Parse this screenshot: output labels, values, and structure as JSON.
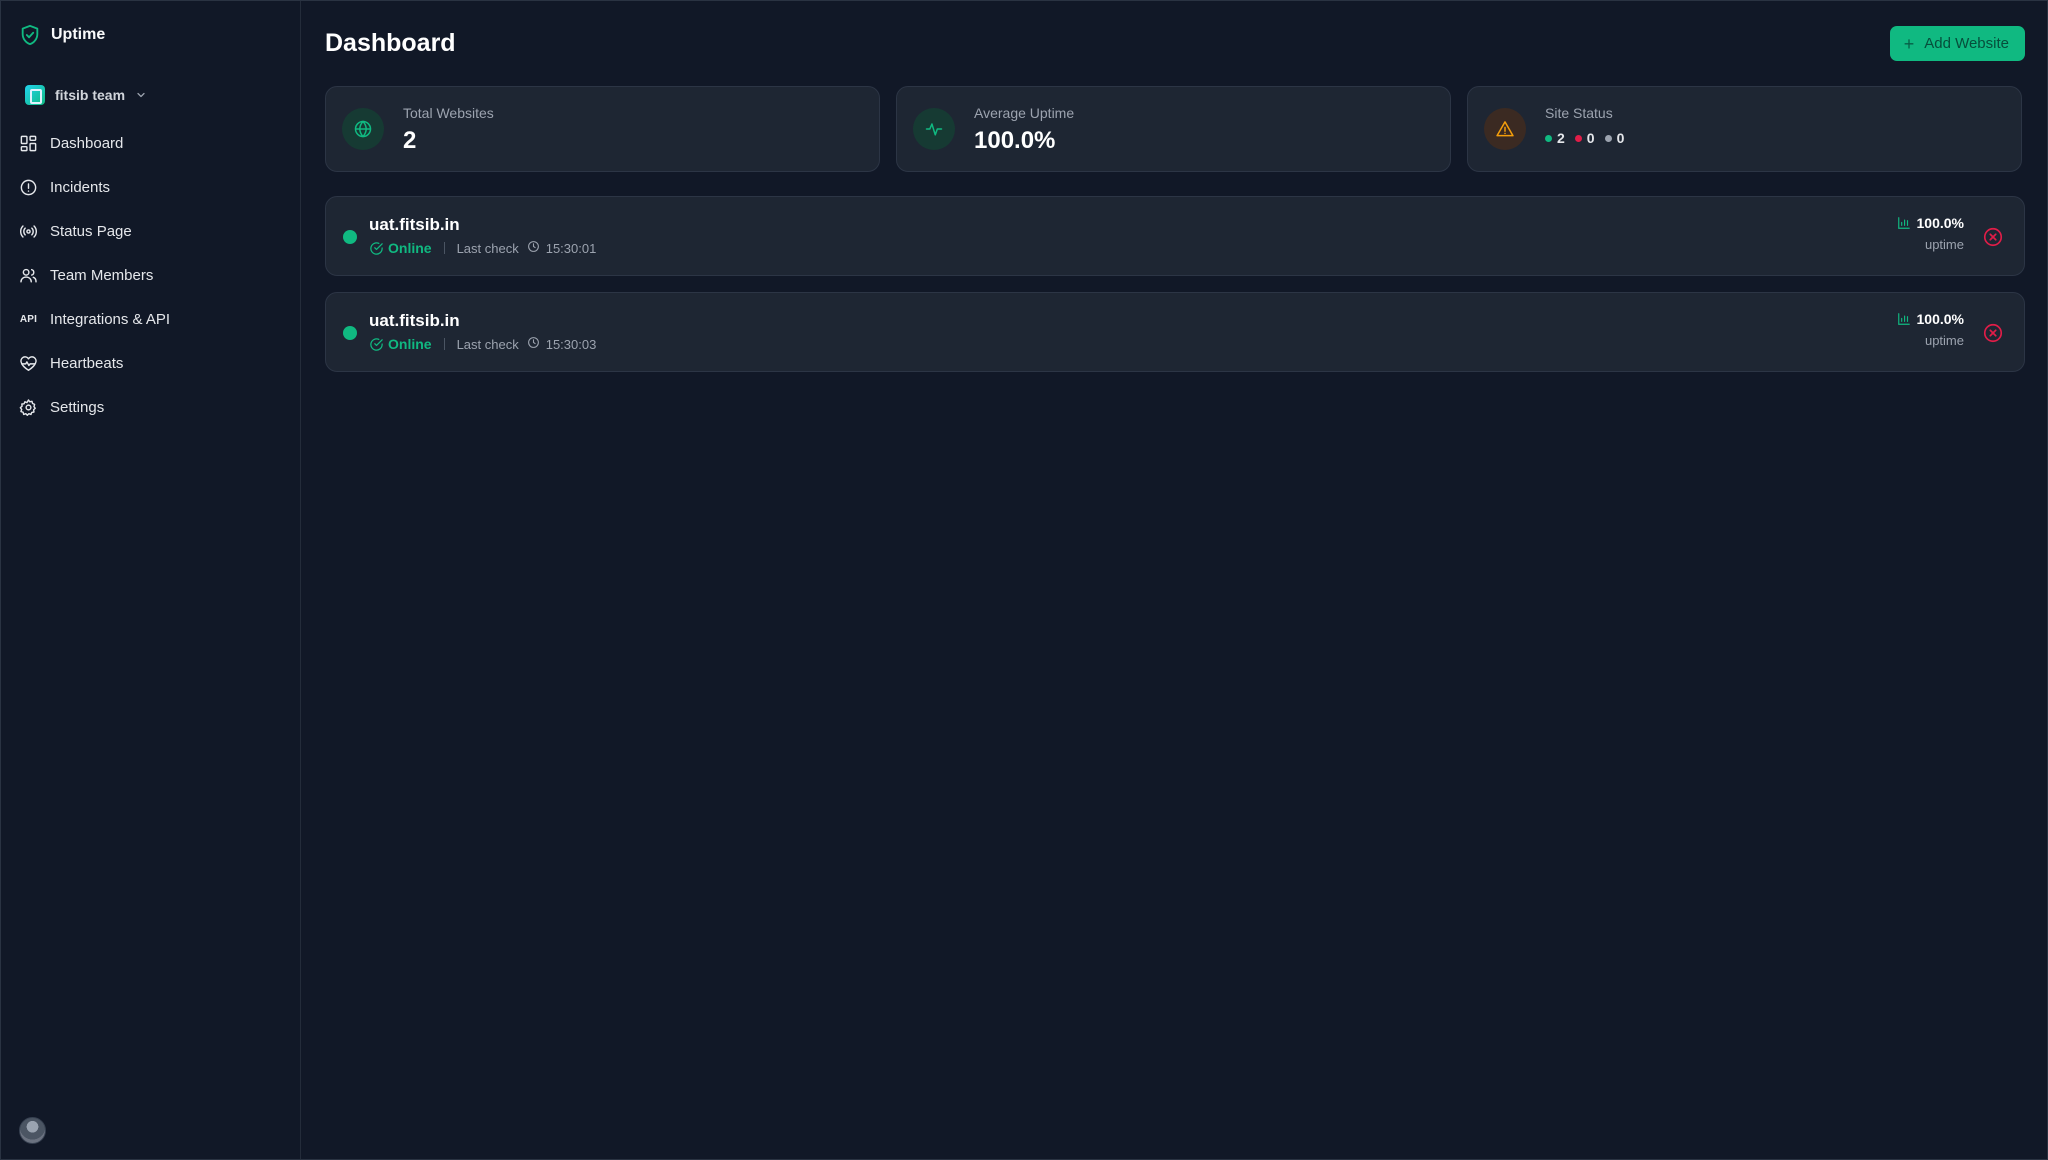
{
  "app": {
    "name": "Uptime"
  },
  "team": {
    "name": "fitsib team"
  },
  "nav": [
    {
      "label": "Dashboard"
    },
    {
      "label": "Incidents"
    },
    {
      "label": "Status Page"
    },
    {
      "label": "Team Members"
    },
    {
      "label": "Integrations & API"
    },
    {
      "label": "Heartbeats"
    },
    {
      "label": "Settings"
    }
  ],
  "header": {
    "title": "Dashboard",
    "add_button_label": "Add Website"
  },
  "stats": {
    "total_websites": {
      "label": "Total Websites",
      "value": "2"
    },
    "average_uptime": {
      "label": "Average Uptime",
      "value": "100.0%"
    },
    "site_status": {
      "label": "Site Status",
      "up": "2",
      "down": "0",
      "unknown": "0"
    }
  },
  "sites": [
    {
      "name": "uat.fitsib.in",
      "status": "Online",
      "last_check_label": "Last check",
      "last_check_time": "15:30:01",
      "uptime": "100.0%",
      "uptime_label": "uptime"
    },
    {
      "name": "uat.fitsib.in",
      "status": "Online",
      "last_check_label": "Last check",
      "last_check_time": "15:30:03",
      "uptime": "100.0%",
      "uptime_label": "uptime"
    }
  ],
  "colors": {
    "accent": "#10b981",
    "background": "#111827",
    "card": "#1e2633",
    "danger": "#e11d48",
    "warning": "#f59e0b",
    "neutral": "#9ca3af"
  },
  "icons": {
    "brand": "shield-check-icon",
    "nav": [
      "grid-icon",
      "alert-circle-icon",
      "broadcast-icon",
      "users-icon",
      "api-icon",
      "heart-pulse-icon",
      "gear-icon"
    ],
    "stats": [
      "globe-icon",
      "activity-icon",
      "warning-triangle-icon"
    ]
  }
}
